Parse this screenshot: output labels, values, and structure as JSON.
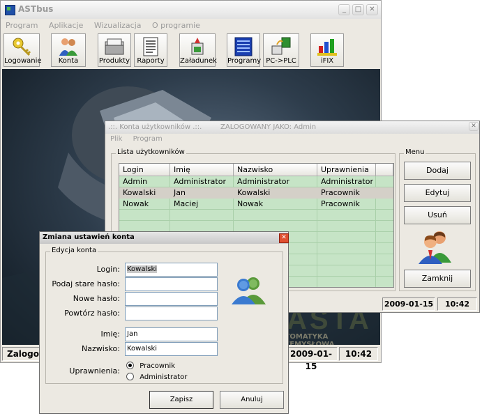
{
  "main_window": {
    "title": "ASTbus",
    "menu": [
      "Program",
      "Aplikacje",
      "Wizualizacja",
      "O programie"
    ],
    "toolbar": [
      {
        "label": "Logowanie",
        "icon": "key-icon"
      },
      {
        "label": "Konta",
        "icon": "users-icon"
      },
      {
        "label": "Produkty",
        "icon": "folder-icon"
      },
      {
        "label": "Raporty",
        "icon": "report-icon"
      },
      {
        "label": "Załadunek",
        "icon": "loading-icon"
      },
      {
        "label": "Programy",
        "icon": "programs-icon"
      },
      {
        "label": "PC->PLC",
        "icon": "pc-plc-icon"
      },
      {
        "label": "iFIX",
        "icon": "ifix-icon"
      }
    ],
    "banner_text": "ASTA",
    "banner_sub": "AUTOMATYKA PRZEMYSŁOWA",
    "status": {
      "user": "Zalogowany",
      "date": "2009-01-15",
      "time": "10:42"
    }
  },
  "accounts_window": {
    "title": ".::. Konta użytkowników .::.",
    "title_extra": "ZALOGOWANY JAKO: Admin",
    "menu": [
      "Plik",
      "Program"
    ],
    "list_group": "Lista użytkowników",
    "columns": [
      "Login",
      "Imię",
      "Nazwisko",
      "Uprawnienia"
    ],
    "rows": [
      {
        "login": "Admin",
        "imie": "Administrator",
        "nazwisko": "Administrator",
        "uprawnienia": "Administrator"
      },
      {
        "login": "Kowalski",
        "imie": "Jan",
        "nazwisko": "Kowalski",
        "uprawnienia": "Pracownik"
      },
      {
        "login": "Nowak",
        "imie": "Maciej",
        "nazwisko": "Nowak",
        "uprawnienia": "Pracownik"
      }
    ],
    "menu_group": "Menu",
    "buttons": {
      "add": "Dodaj",
      "edit": "Edytuj",
      "delete": "Usuń",
      "close": "Zamknij"
    },
    "status": {
      "date": "2009-01-15",
      "time": "10:42"
    }
  },
  "dialog": {
    "title": "Zmiana ustawień konta",
    "group": "Edycja konta",
    "labels": {
      "login": "Login:",
      "old_password": "Podaj stare hasło:",
      "new_password": "Nowe hasło:",
      "repeat_password": "Powtórz hasło:",
      "first_name": "Imię:",
      "last_name": "Nazwisko:",
      "permissions": "Uprawnienia:"
    },
    "values": {
      "login": "Kowalski",
      "old_password": "",
      "new_password": "",
      "repeat_password": "",
      "first_name": "Jan",
      "last_name": "Kowalski"
    },
    "permission_options": [
      "Pracownik",
      "Administrator"
    ],
    "selected_permission": "Pracownik",
    "buttons": {
      "save": "Zapisz",
      "cancel": "Anuluj"
    }
  },
  "colors": {
    "grid_row": "#c6e4c6",
    "grid_selected": "#d4d0c8",
    "dialog_title": "#cfcfcf",
    "close_button": "#e05030"
  }
}
